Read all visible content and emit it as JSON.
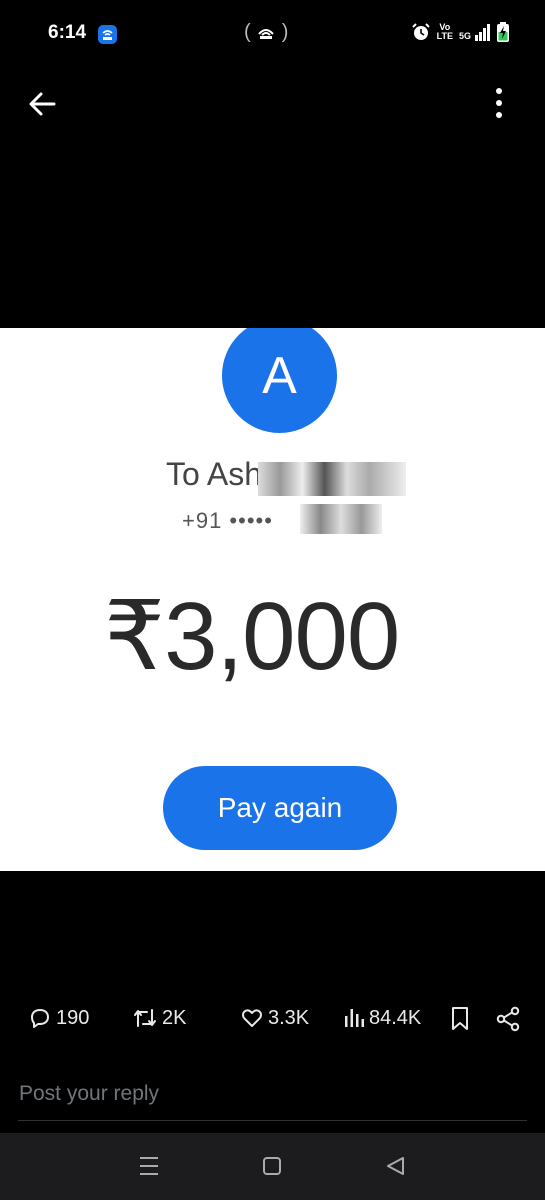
{
  "status_bar": {
    "time": "6:14",
    "center_glyph": "( ",
    "center_glyph_end": " )",
    "volte_line1": "Vo",
    "volte_line2": "LTE",
    "network": "5G"
  },
  "media": {
    "avatar_letter": "A",
    "recipient_prefix": "To Ash",
    "phone_prefix": "+91 •••••",
    "amount": "₹3,000",
    "pay_button": "Pay again"
  },
  "actions": {
    "replies": "190",
    "reposts": "2K",
    "likes": "3.3K",
    "views": "84.4K"
  },
  "reply": {
    "placeholder": "Post your reply"
  },
  "colors": {
    "accent": "#1a73e8",
    "background": "#000000"
  }
}
